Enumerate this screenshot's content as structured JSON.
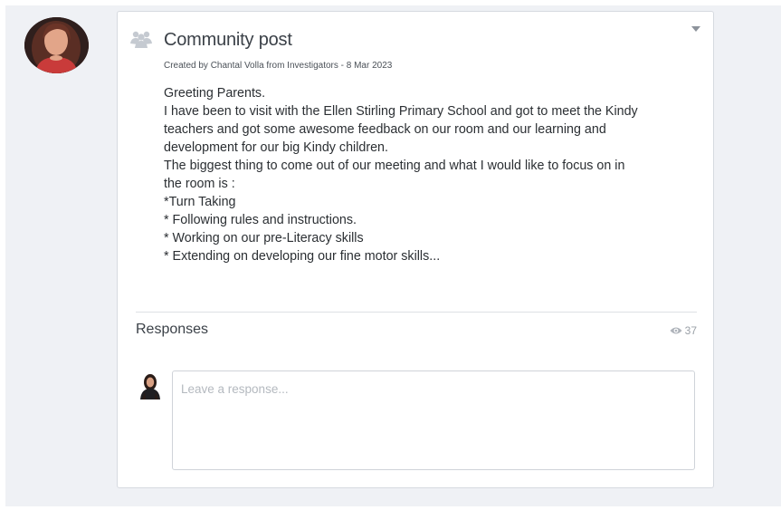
{
  "post": {
    "title": "Community post",
    "meta": "Created by Chantal Volla from Investigators - 8 Mar 2023",
    "body_lines": [
      "Greeting Parents.",
      "I have been to visit with the Ellen Stirling Primary School and got to meet the Kindy",
      "teachers and got some awesome feedback on our room and our learning and",
      "development for our big Kindy children.",
      "The biggest thing to come out of our meeting and what I would like to focus on in",
      "the room is :",
      "*Turn Taking",
      "* Following rules and instructions.",
      "* Working on our pre-Literacy skills",
      "* Extending on developing our fine motor skills..."
    ]
  },
  "responses": {
    "heading": "Responses",
    "views_count": "37",
    "input_placeholder": "Leave a response..."
  },
  "icons": {
    "author_avatar": "author-avatar",
    "post_type": "community-group-icon",
    "menu": "chevron-down-icon",
    "views": "eye-icon",
    "current_user": "user-avatar"
  },
  "colors": {
    "page_background": "#eff1f5",
    "card_background": "#ffffff",
    "muted_text": "#9aa0a7"
  }
}
